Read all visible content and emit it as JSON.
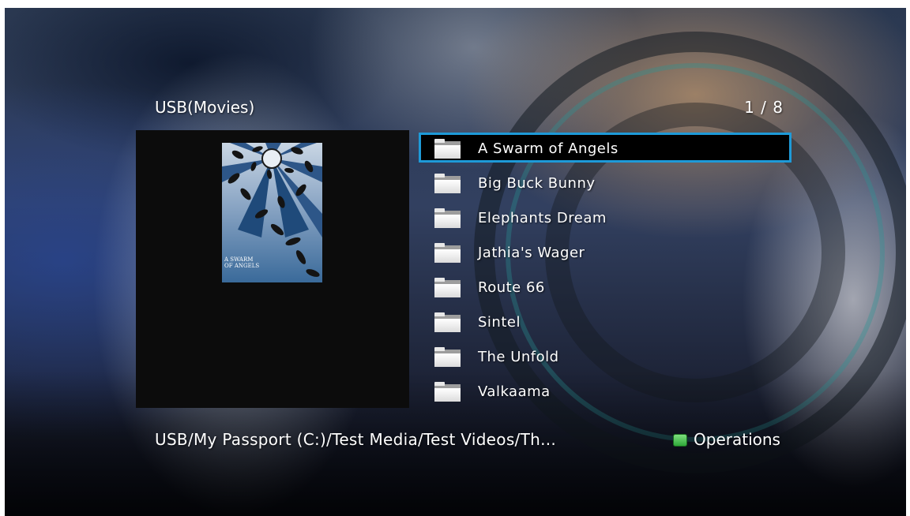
{
  "header": {
    "title": "USB(Movies)",
    "page_counter": "1 / 8"
  },
  "preview": {
    "poster_text": "A SWARM\nOF ANGELS"
  },
  "files": [
    {
      "name": "A Swarm of Angels",
      "icon": "folder-icon",
      "selected": true
    },
    {
      "name": "Big Buck Bunny",
      "icon": "folder-icon",
      "selected": false
    },
    {
      "name": "Elephants Dream",
      "icon": "folder-icon",
      "selected": false
    },
    {
      "name": "Jathia's Wager",
      "icon": "folder-icon",
      "selected": false
    },
    {
      "name": "Route 66",
      "icon": "folder-icon",
      "selected": false
    },
    {
      "name": "Sintel",
      "icon": "folder-icon",
      "selected": false
    },
    {
      "name": "The Unfold",
      "icon": "folder-icon",
      "selected": false
    },
    {
      "name": "Valkaama",
      "icon": "folder-icon",
      "selected": false
    }
  ],
  "footer": {
    "path": "USB/My Passport (C:)/Test Media/Test Videos/Th...",
    "operations_label": "Operations",
    "operations_button_color": "#3cb64a",
    "selection_color": "#1e9ad8"
  }
}
